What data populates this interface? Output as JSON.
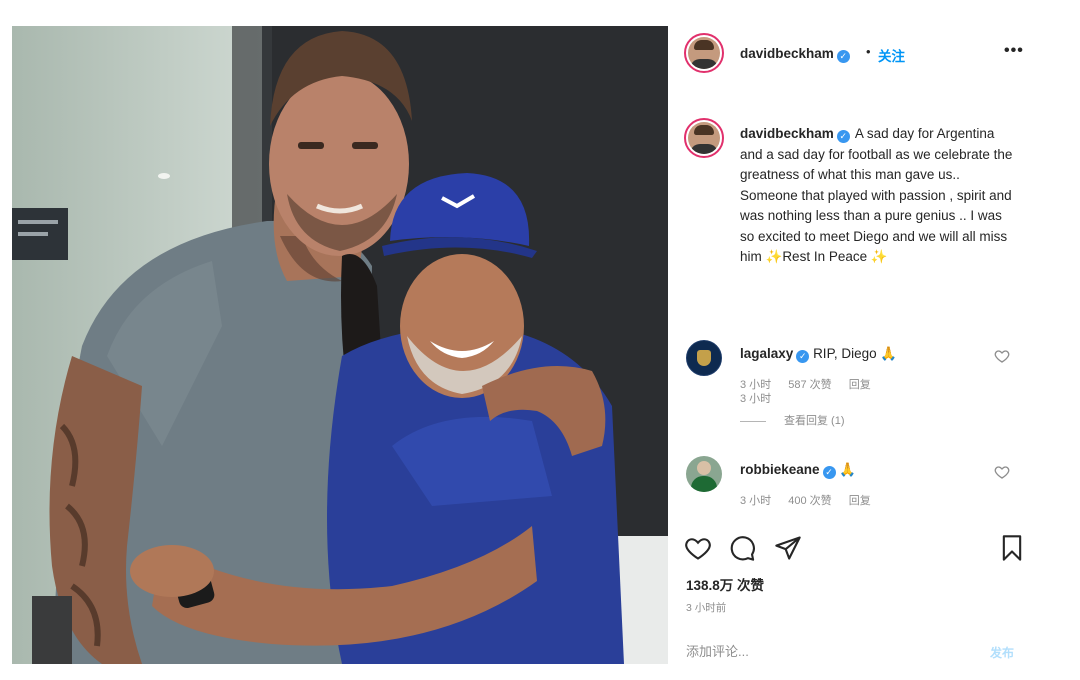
{
  "post": {
    "username": "davidbeckham",
    "follow_separator": "•",
    "follow_label": "关注",
    "more_label": "•••",
    "caption": "A sad day for Argentina and a sad day for football as we celebrate the greatness of what this man gave us.. Someone that played with passion , spirit and was nothing less than a pure genius .. I was so excited to meet Diego and we will all miss him ✨Rest In Peace ✨",
    "caption_time": "3 小时",
    "likes": "138.8万 次赞",
    "post_time": "3 小时前",
    "comment_placeholder": "添加评论...",
    "post_button": "发布"
  },
  "comments": [
    {
      "username": "lagalaxy",
      "text": "RIP, Diego 🙏",
      "time": "3 小时",
      "likes": "587 次赞",
      "reply_label": "回复",
      "view_replies": "查看回复 (1)"
    },
    {
      "username": "robbiekeane",
      "text": "🙏",
      "time": "3 小时",
      "likes": "400 次赞",
      "reply_label": "回复"
    }
  ],
  "icons": {
    "verified": "verified-badge-icon",
    "like": "heart-icon",
    "comment": "comment-bubble-icon",
    "share": "paper-plane-icon",
    "save": "bookmark-icon",
    "more": "more-options-icon"
  },
  "colors": {
    "verified_blue": "#3897f0",
    "follow_blue": "#0095f6",
    "meta_gray": "#8e8e8e",
    "story_ring": "#e1306c"
  }
}
